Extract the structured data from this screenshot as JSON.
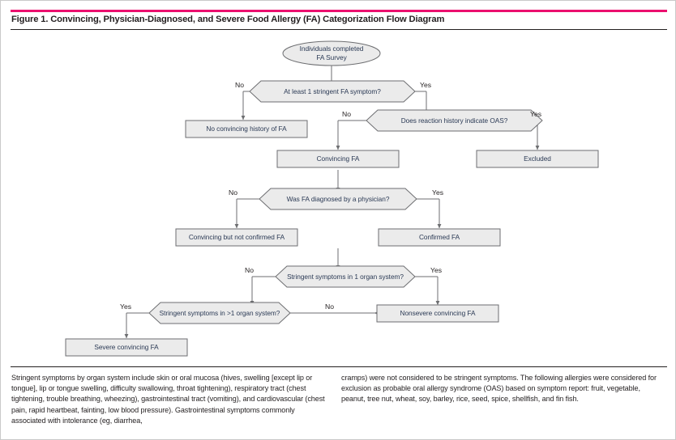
{
  "figure": {
    "title": "Figure 1. Convincing, Physician-Diagnosed, and Severe Food Allergy (FA) Categorization Flow Diagram",
    "accent_color": "#eb0f6e",
    "node_fill": "#ebebeb",
    "node_stroke": "#6d6e71",
    "text_color": "#2b3a55",
    "connector_color": "#6d6e71"
  },
  "diagram": {
    "type": "flowchart",
    "nodes": [
      {
        "id": "start",
        "shape": "ellipse",
        "label_line1": "Individuals completed",
        "label_line2": "FA Survey"
      },
      {
        "id": "q1",
        "shape": "hexagon",
        "label": "At least 1 stringent FA symptom?"
      },
      {
        "id": "no_history",
        "shape": "rectangle",
        "label": "No convincing history of FA"
      },
      {
        "id": "q2",
        "shape": "hexagon",
        "label": "Does reaction history indicate OAS?"
      },
      {
        "id": "convincing",
        "shape": "rectangle",
        "label": "Convincing FA"
      },
      {
        "id": "excluded",
        "shape": "rectangle",
        "label": "Excluded"
      },
      {
        "id": "q3",
        "shape": "hexagon",
        "label": "Was FA diagnosed by a physician?"
      },
      {
        "id": "not_confirmed",
        "shape": "rectangle",
        "label": "Convincing but not confirmed FA"
      },
      {
        "id": "confirmed",
        "shape": "rectangle",
        "label": "Confirmed FA"
      },
      {
        "id": "q4",
        "shape": "hexagon",
        "label": "Stringent symptoms in 1 organ system?"
      },
      {
        "id": "q5",
        "shape": "hexagon",
        "label": "Stringent symptoms in >1 organ system?"
      },
      {
        "id": "nonsevere",
        "shape": "rectangle",
        "label": "Nonsevere convincing FA"
      },
      {
        "id": "severe",
        "shape": "rectangle",
        "label": "Severe convincing FA"
      }
    ],
    "edge_labels": {
      "q1_no": "No",
      "q1_yes": "Yes",
      "q2_no": "No",
      "q2_yes": "Yes",
      "q3_no": "No",
      "q3_yes": "Yes",
      "q4_no": "No",
      "q4_yes": "Yes",
      "q5_yes": "Yes",
      "q5_no": "No"
    }
  },
  "footnote": {
    "left": "Stringent symptoms by organ system include skin or oral mucosa (hives, swelling [except lip or tongue], lip or tongue swelling, difficulty swallowing, throat tightening), respiratory tract (chest tightening, trouble breathing, wheezing), gastrointestinal tract (vomiting), and cardiovascular (chest pain, rapid heartbeat, fainting, low blood pressure). Gastrointestinal symptoms commonly associated with intolerance (eg, diarrhea,",
    "right": "cramps) were not considered to be stringent symptoms. The following allergies were considered for exclusion as probable oral allergy syndrome (OAS) based on symptom report: fruit, vegetable, peanut, tree nut, wheat, soy, barley, rice, seed, spice, shellfish, and fin fish."
  }
}
